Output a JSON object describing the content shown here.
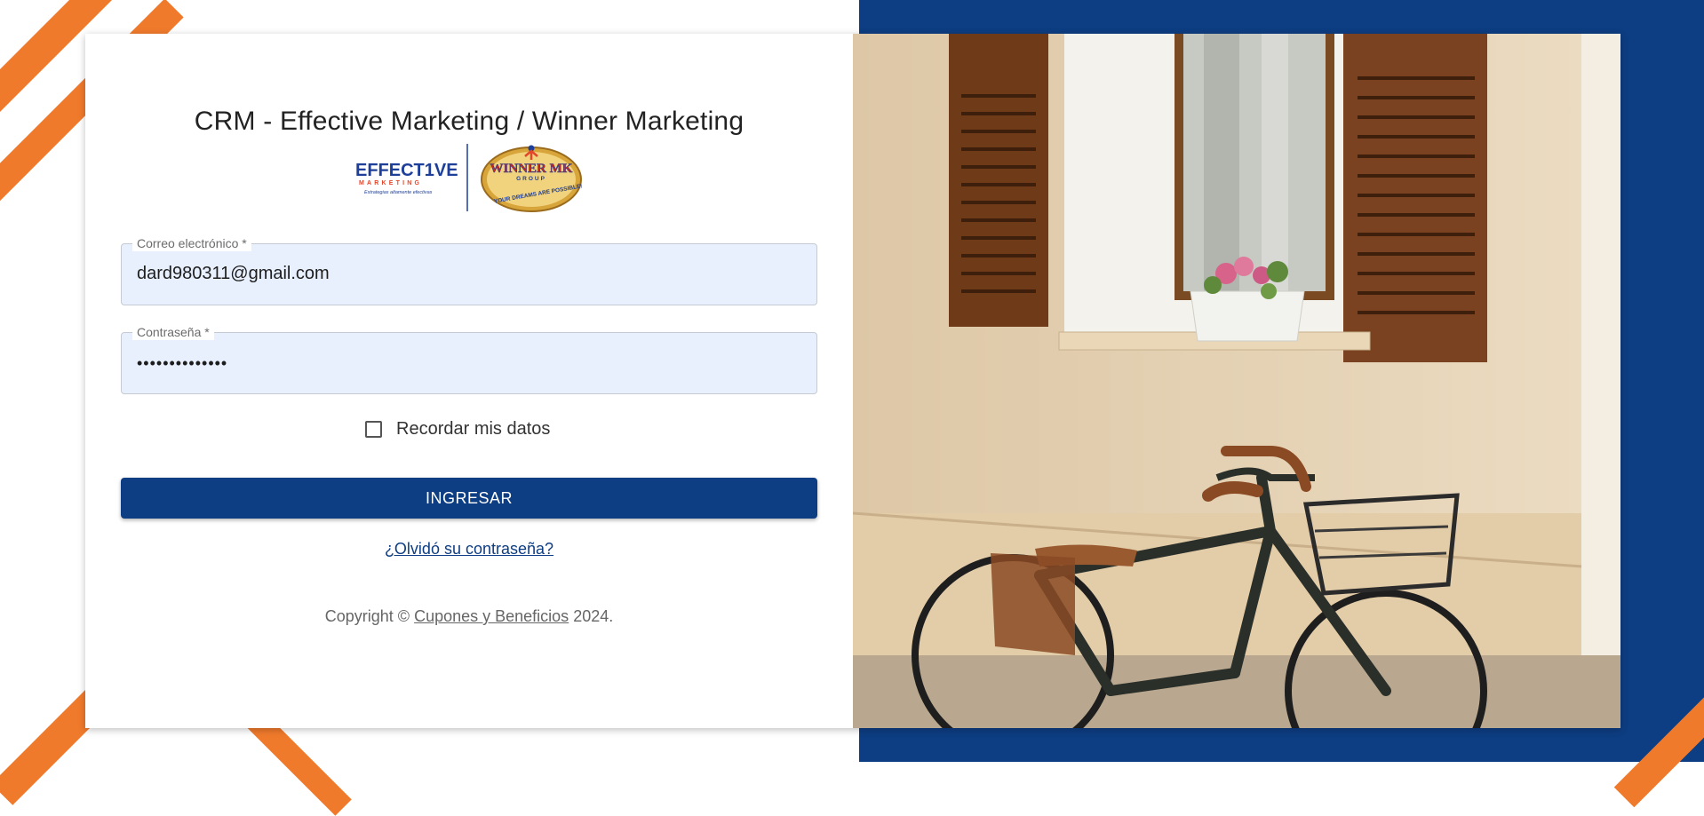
{
  "colors": {
    "brand_blue": "#0d3d82",
    "accent_orange": "#f07a2c",
    "input_bg": "#e8f0fe"
  },
  "header": {
    "title": "CRM - Effective Marketing / Winner Marketing",
    "logo_left": {
      "name": "effective-marketing-logo",
      "text": "EFFECT1VE",
      "subtext": "MARKETING",
      "tagline": "Estrategias altamente efectivas"
    },
    "logo_right": {
      "name": "winner-mk-group-logo",
      "text": "WINNER MK",
      "subtext": "GROUP",
      "tagline": "YOUR DREAMS ARE POSSIBLE!"
    }
  },
  "form": {
    "email": {
      "label": "Correo electrónico *",
      "value": "dard980311@gmail.com"
    },
    "password": {
      "label": "Contraseña *",
      "value": "••••••••••••••"
    },
    "remember_label": "Recordar mis datos",
    "remember_checked": false,
    "submit_label": "INGRESAR",
    "forgot_link": "¿Olvidó su contraseña?"
  },
  "footer": {
    "prefix": "Copyright © ",
    "link": "Cupones y Beneficios",
    "suffix": " 2024."
  },
  "side_image": {
    "icon": "bicycle-window-photo"
  }
}
